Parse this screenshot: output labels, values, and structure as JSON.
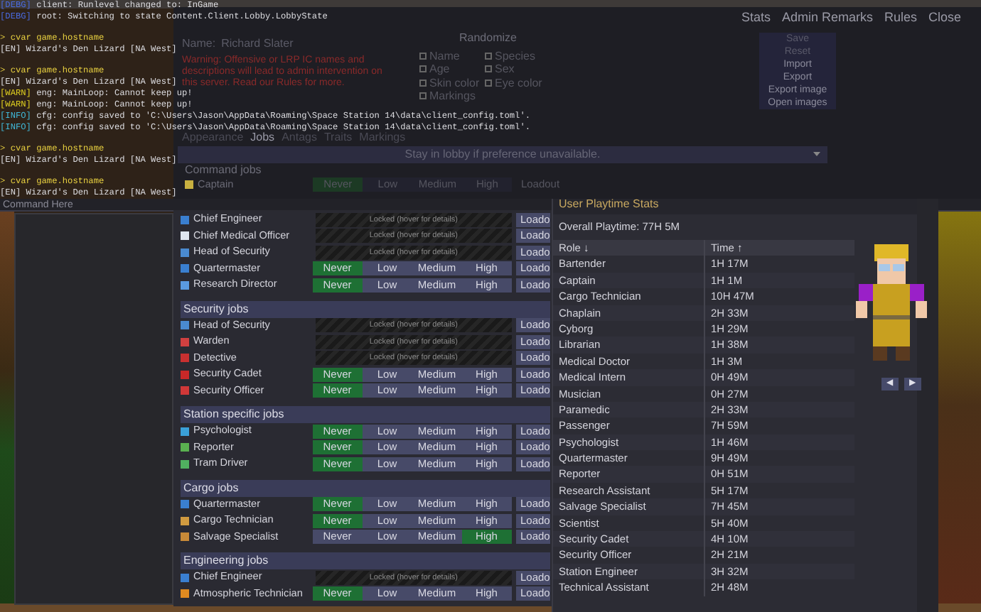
{
  "console": {
    "lines": [
      {
        "kind": "debug",
        "tag": "[DEBG]",
        "text": " client: Runlevel changed to: InGame"
      },
      {
        "kind": "debug",
        "tag": "[DEBG]",
        "text": " root: Switching to state Content.Client.Lobby.LobbyState"
      },
      {
        "kind": "command",
        "text": "> cvar game.hostname"
      },
      {
        "kind": "output",
        "text": "[EN] Wizard's Den Lizard [NA West]"
      },
      {
        "kind": "command",
        "text": "> cvar game.hostname"
      },
      {
        "kind": "output",
        "text": "[EN] Wizard's Den Lizard [NA West]"
      },
      {
        "kind": "warn",
        "tag": "[WARN]",
        "text": " eng: MainLoop: Cannot keep up!"
      },
      {
        "kind": "warn",
        "tag": "[WARN]",
        "text": " eng: MainLoop: Cannot keep up!"
      },
      {
        "kind": "info",
        "tag": "[INFO]",
        "text": " cfg: config saved to 'C:\\Users\\Jason\\AppData\\Roaming\\Space Station 14\\data\\client_config.toml'."
      },
      {
        "kind": "info",
        "tag": "[INFO]",
        "text": " cfg: config saved to 'C:\\Users\\Jason\\AppData\\Roaming\\Space Station 14\\data\\client_config.toml'."
      },
      {
        "kind": "command",
        "text": "> cvar game.hostname"
      },
      {
        "kind": "output",
        "text": "[EN] Wizard's Den Lizard [NA West]"
      },
      {
        "kind": "command",
        "text": "> cvar game.hostname"
      },
      {
        "kind": "output",
        "text": "[EN] Wizard's Den Lizard [NA West]"
      }
    ],
    "input": {
      "placeholder": "Command Here"
    }
  },
  "editor": {
    "menu": [
      "Stats",
      "Admin Remarks",
      "Rules",
      "Close"
    ],
    "name_label": "Name:",
    "name_value": "Richard Slater",
    "warning": "Warning: Offensive or LRP IC names and descriptions will lead to admin intervention on this server. Read our Rules for more.",
    "randomize": {
      "title": "Randomize",
      "options": [
        {
          "label": "Name",
          "checked": false
        },
        {
          "label": "Species",
          "checked": false
        },
        {
          "label": "Age",
          "checked": false
        },
        {
          "label": "Sex",
          "checked": false
        },
        {
          "label": "Skin color",
          "checked": false
        },
        {
          "label": "Eye color",
          "checked": false
        },
        {
          "label": "Markings",
          "checked": false
        }
      ]
    },
    "actions": [
      {
        "label": "Save",
        "disabled": true
      },
      {
        "label": "Reset",
        "disabled": true
      },
      {
        "label": "Import",
        "disabled": false
      },
      {
        "label": "Export",
        "disabled": false
      },
      {
        "label": "Export image",
        "disabled": false
      },
      {
        "label": "Open images",
        "disabled": false
      }
    ],
    "tabs": [
      {
        "label": "Appearance",
        "selected": false
      },
      {
        "label": "Jobs",
        "selected": true
      },
      {
        "label": "Antags",
        "selected": false
      },
      {
        "label": "Traits",
        "selected": false
      },
      {
        "label": "Markings",
        "selected": false
      }
    ],
    "lobby_preference": "Stay in lobby if preference unavailable.",
    "group": {
      "title": "Command jobs",
      "jobs": [
        {
          "name": "Captain",
          "kind": "priority",
          "color": "#c8b040",
          "levels": [
            {
              "label": "Never",
              "selected": true
            },
            {
              "label": "Low",
              "selected": false
            },
            {
              "label": "Medium",
              "selected": false
            },
            {
              "label": "High",
              "selected": false
            }
          ],
          "loadout": "Loadout"
        }
      ]
    }
  },
  "jobs": {
    "groups": [
      {
        "jobs": [
          {
            "name": "Chief Engineer",
            "kind": "locked",
            "color": "#3a7fd0",
            "locked_text": "Locked (hover for details)",
            "loadout": "Loado"
          },
          {
            "name": "Chief Medical Officer",
            "kind": "locked",
            "color": "#dfe6f0",
            "locked_text": "Locked (hover for details)",
            "loadout": "Loado"
          },
          {
            "name": "Head of Security",
            "kind": "locked",
            "color": "#4a8ad0",
            "locked_text": "Locked (hover for details)",
            "loadout": "Loado"
          },
          {
            "name": "Quartermaster",
            "kind": "priority",
            "color": "#3a7fd0",
            "levels": [
              {
                "label": "Never",
                "selected": true
              },
              {
                "label": "Low",
                "selected": false
              },
              {
                "label": "Medium",
                "selected": false
              },
              {
                "label": "High",
                "selected": false
              }
            ],
            "loadout": "Loado"
          },
          {
            "name": "Research Director",
            "kind": "priority",
            "color": "#5a9ae0",
            "levels": [
              {
                "label": "Never",
                "selected": true
              },
              {
                "label": "Low",
                "selected": false
              },
              {
                "label": "Medium",
                "selected": false
              },
              {
                "label": "High",
                "selected": false
              }
            ],
            "loadout": "Loado"
          }
        ]
      },
      {
        "title": "Security jobs",
        "jobs": [
          {
            "name": "Head of Security",
            "kind": "locked",
            "color": "#4a8ad0",
            "locked_text": "Locked (hover for details)",
            "loadout": "Loado"
          },
          {
            "name": "Warden",
            "kind": "locked",
            "color": "#d04040",
            "locked_text": "Locked (hover for details)",
            "loadout": "Loado"
          },
          {
            "name": "Detective",
            "kind": "locked",
            "color": "#c83030",
            "locked_text": "Locked (hover for details)",
            "loadout": "Loado"
          },
          {
            "name": "Security Cadet",
            "kind": "priority",
            "color": "#c82828",
            "levels": [
              {
                "label": "Never",
                "selected": true
              },
              {
                "label": "Low",
                "selected": false
              },
              {
                "label": "Medium",
                "selected": false
              },
              {
                "label": "High",
                "selected": false
              }
            ],
            "loadout": "Loado"
          },
          {
            "name": "Security Officer",
            "kind": "priority",
            "color": "#d03838",
            "levels": [
              {
                "label": "Never",
                "selected": true
              },
              {
                "label": "Low",
                "selected": false
              },
              {
                "label": "Medium",
                "selected": false
              },
              {
                "label": "High",
                "selected": false
              }
            ],
            "loadout": "Loado"
          }
        ]
      },
      {
        "title": "Station specific jobs",
        "jobs": [
          {
            "name": "Psychologist",
            "kind": "priority",
            "color": "#3aa0d8",
            "levels": [
              {
                "label": "Never",
                "selected": true
              },
              {
                "label": "Low",
                "selected": false
              },
              {
                "label": "Medium",
                "selected": false
              },
              {
                "label": "High",
                "selected": false
              }
            ],
            "loadout": "Loado"
          },
          {
            "name": "Reporter",
            "kind": "priority",
            "color": "#5ab050",
            "levels": [
              {
                "label": "Never",
                "selected": true
              },
              {
                "label": "Low",
                "selected": false
              },
              {
                "label": "Medium",
                "selected": false
              },
              {
                "label": "High",
                "selected": false
              }
            ],
            "loadout": "Loado"
          },
          {
            "name": "Tram Driver",
            "kind": "priority",
            "color": "#50b060",
            "levels": [
              {
                "label": "Never",
                "selected": true
              },
              {
                "label": "Low",
                "selected": false
              },
              {
                "label": "Medium",
                "selected": false
              },
              {
                "label": "High",
                "selected": false
              }
            ],
            "loadout": "Loado"
          }
        ]
      },
      {
        "title": "Cargo jobs",
        "jobs": [
          {
            "name": "Quartermaster",
            "kind": "priority",
            "color": "#3a7fd0",
            "levels": [
              {
                "label": "Never",
                "selected": true
              },
              {
                "label": "Low",
                "selected": false
              },
              {
                "label": "Medium",
                "selected": false
              },
              {
                "label": "High",
                "selected": false
              }
            ],
            "loadout": "Loado"
          },
          {
            "name": "Cargo Technician",
            "kind": "priority",
            "color": "#d09a40",
            "levels": [
              {
                "label": "Never",
                "selected": true
              },
              {
                "label": "Low",
                "selected": false
              },
              {
                "label": "Medium",
                "selected": false
              },
              {
                "label": "High",
                "selected": false
              }
            ],
            "loadout": "Loado"
          },
          {
            "name": "Salvage Specialist",
            "kind": "priority",
            "color": "#c88a38",
            "levels": [
              {
                "label": "Never",
                "selected": false
              },
              {
                "label": "Low",
                "selected": false
              },
              {
                "label": "Medium",
                "selected": false
              },
              {
                "label": "High",
                "selected": true
              }
            ],
            "loadout": "Loado"
          }
        ]
      },
      {
        "title": "Engineering jobs",
        "jobs": [
          {
            "name": "Chief Engineer",
            "kind": "locked",
            "color": "#3a7fd0",
            "locked_text": "Locked (hover for details)",
            "loadout": "Loado"
          },
          {
            "name": "Atmospheric Technician",
            "kind": "priority",
            "color": "#e08a20",
            "levels": [
              {
                "label": "Never",
                "selected": true
              },
              {
                "label": "Low",
                "selected": false
              },
              {
                "label": "Medium",
                "selected": false
              },
              {
                "label": "High",
                "selected": false
              }
            ],
            "loadout": "Loado"
          }
        ]
      }
    ]
  },
  "playtime": {
    "title": "User Playtime Stats",
    "overall": "Overall Playtime: 77H 5M",
    "columns": [
      "Role ↓",
      "Time ↑"
    ],
    "rows": [
      [
        "Bartender",
        "1H 17M"
      ],
      [
        "Captain",
        "1H 1M"
      ],
      [
        "Cargo Technician",
        "10H 47M"
      ],
      [
        "Chaplain",
        "2H 33M"
      ],
      [
        "Cyborg",
        "1H 29M"
      ],
      [
        "Librarian",
        "1H 38M"
      ],
      [
        "Medical Doctor",
        "1H 3M"
      ],
      [
        "Medical Intern",
        "0H 49M"
      ],
      [
        "Musician",
        "0H 27M"
      ],
      [
        "Paramedic",
        "2H 33M"
      ],
      [
        "Passenger",
        "7H 59M"
      ],
      [
        "Psychologist",
        "1H 46M"
      ],
      [
        "Quartermaster",
        "9H 49M"
      ],
      [
        "Reporter",
        "0H 51M"
      ],
      [
        "Research Assistant",
        "5H 17M"
      ],
      [
        "Salvage Specialist",
        "7H 45M"
      ],
      [
        "Scientist",
        "5H 40M"
      ],
      [
        "Security Cadet",
        "4H 10M"
      ],
      [
        "Security Officer",
        "2H 21M"
      ],
      [
        "Station Engineer",
        "3H 32M"
      ],
      [
        "Technical Assistant",
        "2H 48M"
      ]
    ]
  },
  "character": {
    "prev": "◀",
    "next": "▶"
  }
}
